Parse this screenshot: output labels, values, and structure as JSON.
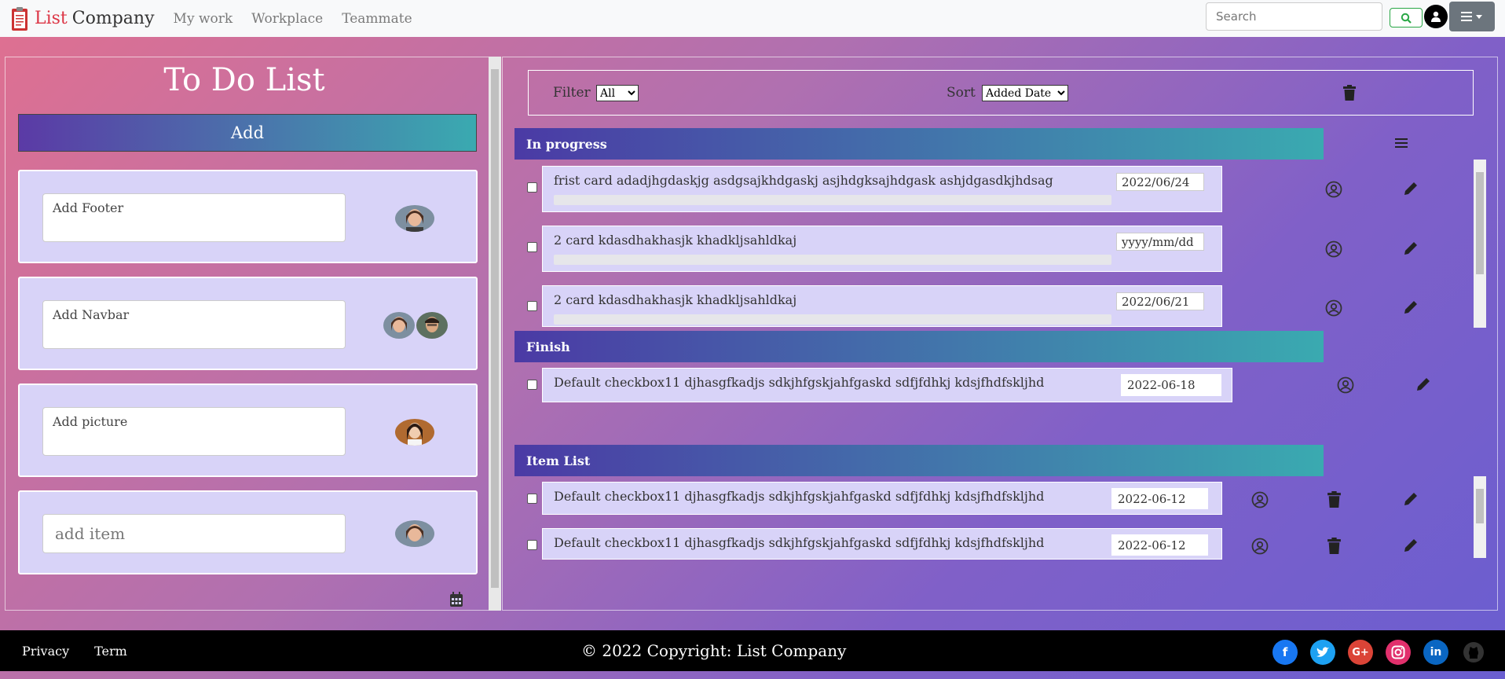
{
  "nav": {
    "brand_1": "List",
    "brand_2": "Company",
    "links": [
      "My work",
      "Workplace",
      "Teammate"
    ],
    "search_placeholder": "Search"
  },
  "left": {
    "title": "To Do List",
    "add_label": "Add",
    "tasks": [
      {
        "text": "Add Footer"
      },
      {
        "text": "Add Navbar"
      },
      {
        "text": "Add picture"
      }
    ],
    "add_item_placeholder": "add item"
  },
  "right": {
    "filter_label": "Filter",
    "filter_value": "All",
    "sort_label": "Sort",
    "sort_value": "Added Date",
    "groups": {
      "in_progress": "In progress",
      "finish": "Finish",
      "item_list": "Item List"
    },
    "in_progress_cards": [
      {
        "text": "frist card adadjhgdaskjg asdgsajkhdgaskj asjhdgksajhdgask ashjdgasdkjhdsag",
        "date": "2022/06/24"
      },
      {
        "text": "2 card kdasdhakhasjk khadkljsahldkaj",
        "date": "yyyy/mm/dd"
      },
      {
        "text": "2 card kdasdhakhasjk khadkljsahldkaj",
        "date": "2022/06/21"
      }
    ],
    "finish_cards": [
      {
        "text": "Default checkbox11 djhasgfkadjs sdkjhfgskjahfgaskd sdfjfdhkj kdsjfhdfskljhd",
        "date": "2022-06-18"
      }
    ],
    "item_list_cards": [
      {
        "text": "Default checkbox11 djhasgfkadjs sdkjhfgskjahfgaskd sdfjfdhkj kdsjfhdfskljhd",
        "date": "2022-06-12"
      },
      {
        "text": "Default checkbox11 djhasgfkadjs sdkjhfgskjahfgaskd sdfjfdhkj kdsjfhdfskljhd",
        "date": "2022-06-12"
      }
    ]
  },
  "footer": {
    "privacy": "Privacy",
    "term": "Term",
    "copyright": "© 2022 Copyright: List Company"
  },
  "colors": {
    "facebook": "#1877f2",
    "twitter": "#1da1f2",
    "google": "#db4437",
    "instagram": "#e1306c",
    "linkedin": "#0a66c2",
    "github": "#333333"
  }
}
